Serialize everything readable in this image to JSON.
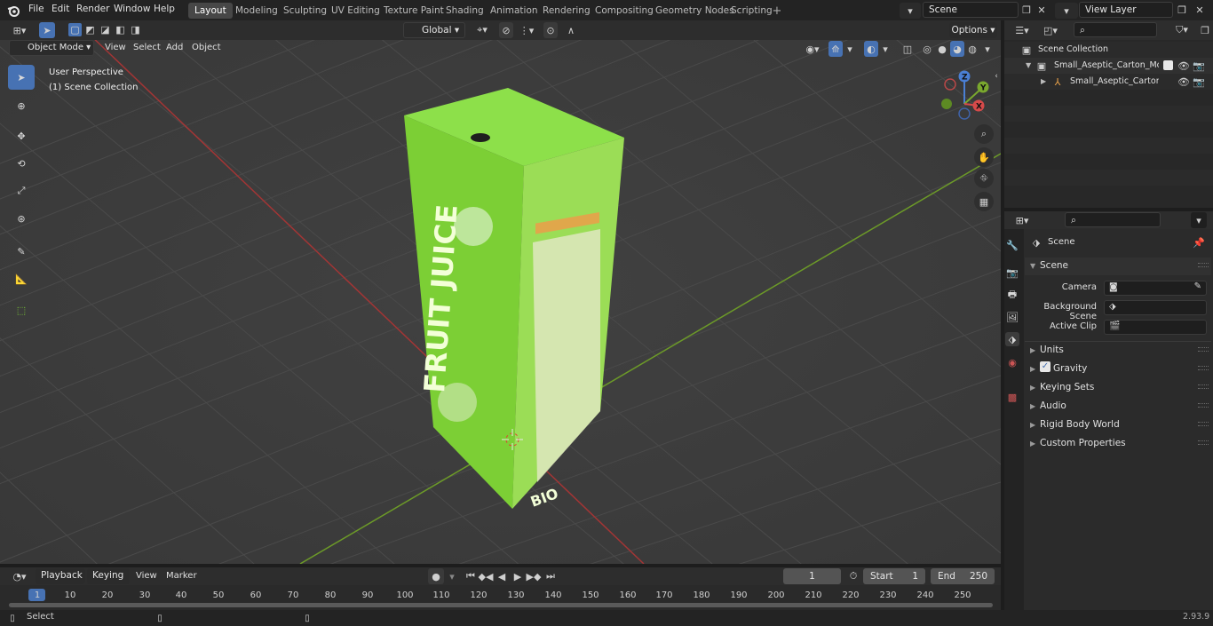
{
  "menus": [
    "File",
    "Edit",
    "Render",
    "Window",
    "Help"
  ],
  "workspaces": [
    "Layout",
    "Modeling",
    "Sculpting",
    "UV Editing",
    "Texture Paint",
    "Shading",
    "Animation",
    "Rendering",
    "Compositing",
    "Geometry Nodes",
    "Scripting"
  ],
  "scene_name": "Scene",
  "view_layer": "View Layer",
  "viewport": {
    "mode": "Object Mode",
    "menu": [
      "View",
      "Select",
      "Add",
      "Object"
    ],
    "transform_orientation": "Global",
    "options_label": "Options",
    "overlay_title": "User Perspective",
    "overlay_collection": "(1) Scene Collection",
    "gizmo": {
      "x": "X",
      "y": "Y",
      "z": "Z"
    },
    "carton_text": "FRUIT JUICE",
    "carton_brand": "BIO"
  },
  "outliner": {
    "root": "Scene Collection",
    "items": [
      "Small_Aseptic_Carton_Mocku",
      "Small_Aseptic_Carton_Mc"
    ]
  },
  "properties": {
    "context": "Scene",
    "section": "Scene",
    "fields": [
      {
        "label": "Camera"
      },
      {
        "label": "Background Scene"
      },
      {
        "label": "Active Clip"
      }
    ],
    "panels": [
      "Units",
      "Gravity",
      "Keying Sets",
      "Audio",
      "Rigid Body World",
      "Custom Properties"
    ]
  },
  "timeline": {
    "menus": [
      "Playback",
      "Keying",
      "View",
      "Marker"
    ],
    "current_frame": "1",
    "start_label": "Start",
    "start": "1",
    "end_label": "End",
    "end": "250",
    "ticks": [
      "1",
      "10",
      "20",
      "30",
      "40",
      "50",
      "60",
      "70",
      "80",
      "90",
      "100",
      "110",
      "120",
      "130",
      "140",
      "150",
      "160",
      "170",
      "180",
      "190",
      "200",
      "210",
      "220",
      "230",
      "240",
      "250"
    ]
  },
  "status": {
    "left": "Select",
    "version": "2.93.9"
  },
  "colors": {
    "accent": "#4772b3",
    "viewport_bg": "#3c3c3c",
    "axis_x": "#a33535",
    "axis_y": "#6c9a28",
    "carton": "#7fd33a"
  }
}
